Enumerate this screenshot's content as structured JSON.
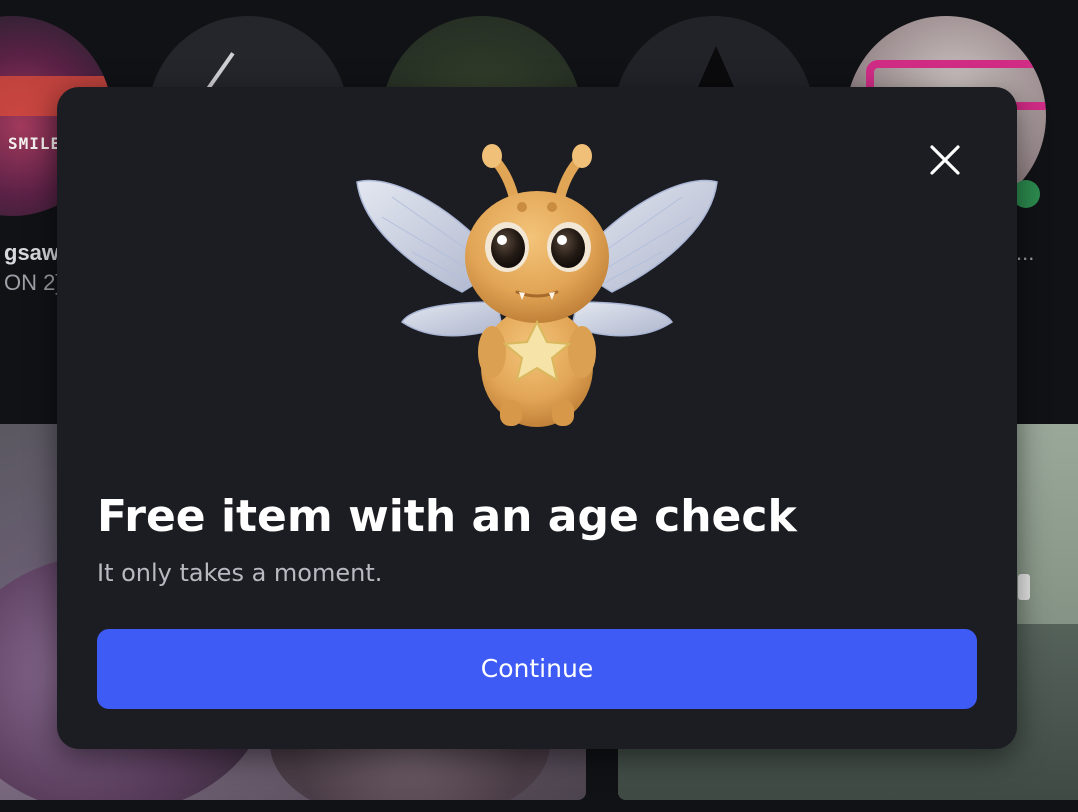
{
  "background": {
    "friend_names": [
      "gsaw",
      "ON 2]",
      "..."
    ],
    "avatar_caption": "SMILE"
  },
  "modal": {
    "title": "Free item with an age check",
    "subtitle": "It only takes a moment.",
    "continue_label": "Continue",
    "close_icon": "close-icon",
    "item_image": "bee-fairy-accessory-icon",
    "colors": {
      "panel": "#1c1d22",
      "button": "#3e5bf6",
      "title": "#ffffff",
      "subtitle": "#b8bac2"
    }
  }
}
